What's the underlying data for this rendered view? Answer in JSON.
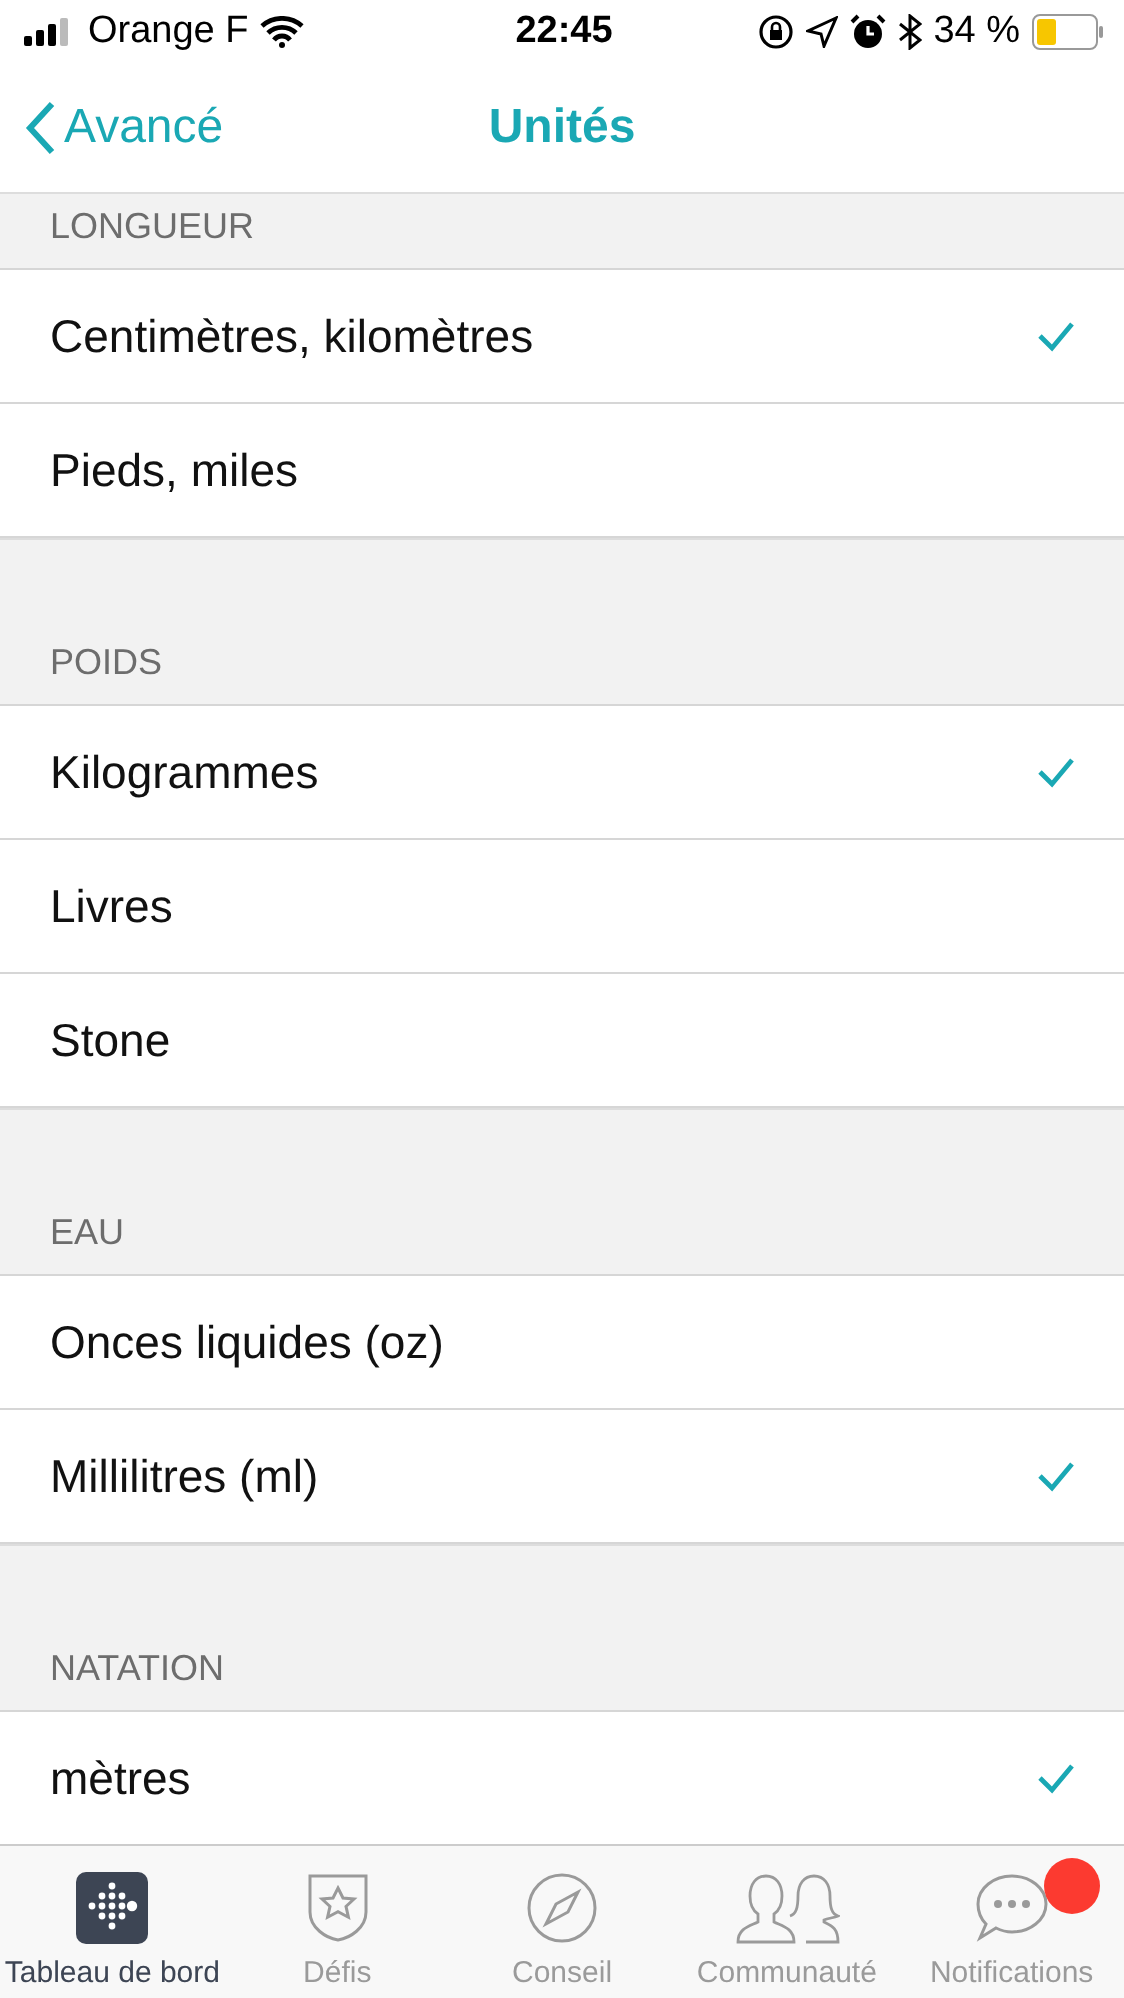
{
  "status_bar": {
    "carrier": "Orange F",
    "time": "22:45",
    "battery": "34 %"
  },
  "nav": {
    "back": "Avancé",
    "title": "Unités"
  },
  "sections": [
    {
      "title": "LONGUEUR",
      "options": [
        {
          "label": "Centimètres, kilomètres",
          "selected": true
        },
        {
          "label": "Pieds, miles",
          "selected": false
        }
      ]
    },
    {
      "title": "POIDS",
      "options": [
        {
          "label": "Kilogrammes",
          "selected": true
        },
        {
          "label": "Livres",
          "selected": false
        },
        {
          "label": "Stone",
          "selected": false
        }
      ]
    },
    {
      "title": "EAU",
      "options": [
        {
          "label": "Onces liquides (oz)",
          "selected": false
        },
        {
          "label": "Millilitres (ml)",
          "selected": true
        }
      ]
    },
    {
      "title": "NATATION",
      "options": [
        {
          "label": "mètres",
          "selected": true
        }
      ]
    }
  ],
  "tab_bar": [
    {
      "label": "Tableau de bord",
      "selected": true,
      "badge": false
    },
    {
      "label": "Défis",
      "selected": false,
      "badge": false
    },
    {
      "label": "Conseil",
      "selected": false,
      "badge": false
    },
    {
      "label": "Communauté",
      "selected": false,
      "badge": false
    },
    {
      "label": "Notifications",
      "selected": false,
      "badge": true
    }
  ]
}
